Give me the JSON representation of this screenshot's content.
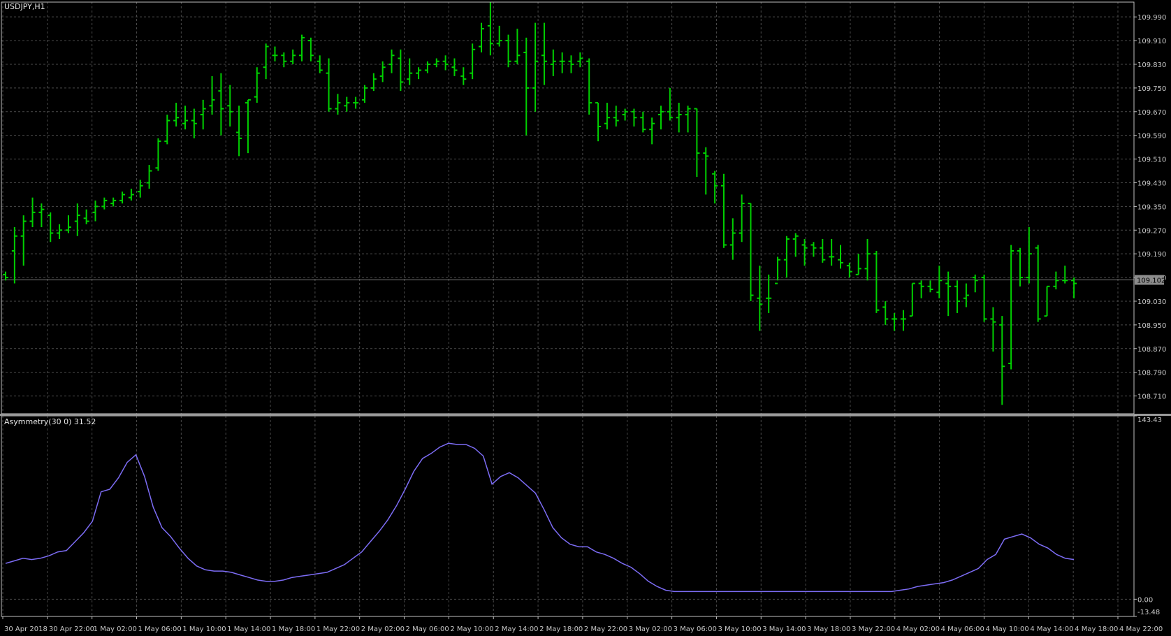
{
  "window": {
    "symbol_label": "USDJPY,H1",
    "indicator_label": "Asymmetry(30 0) 31.52"
  },
  "colors": {
    "background": "#000000",
    "grid": "#4a4a4a",
    "frame": "#c0c0c0",
    "bars": "#00d000",
    "indicator_line": "#7c6cf4",
    "bid_line": "#808080",
    "price_marker_bg": "#8c8c8c",
    "text": "#c8c8c8"
  },
  "chart_data": [
    {
      "type": "ohlc",
      "title": "USDJPY,H1",
      "bar_color": "#00d000",
      "y_ticks": [
        "109.990",
        "109.910",
        "109.830",
        "109.750",
        "109.670",
        "109.590",
        "109.510",
        "109.430",
        "109.350",
        "109.270",
        "109.190",
        "109.110",
        "109.030",
        "108.950",
        "108.870",
        "108.790",
        "108.710"
      ],
      "current_price": "109.102",
      "ylim": [
        108.65,
        110.04
      ],
      "x_ticks": [
        "30 Apr 2018",
        "30 Apr 22:00",
        "1 May 02:00",
        "1 May 06:00",
        "1 May 10:00",
        "1 May 14:00",
        "1 May 18:00",
        "1 May 22:00",
        "2 May 02:00",
        "2 May 06:00",
        "2 May 10:00",
        "2 May 14:00",
        "2 May 18:00",
        "2 May 22:00",
        "3 May 02:00",
        "3 May 06:00",
        "3 May 10:00",
        "3 May 14:00",
        "3 May 18:00",
        "3 May 22:00",
        "4 May 02:00",
        "4 May 06:00",
        "4 May 10:00",
        "4 May 14:00",
        "4 May 18:00",
        "4 May 22:00"
      ],
      "bars": [
        [
          109.12,
          109.13,
          109.1,
          109.11
        ],
        [
          109.2,
          109.28,
          109.09,
          109.25
        ],
        [
          109.25,
          109.32,
          109.15,
          109.3
        ],
        [
          109.3,
          109.38,
          109.28,
          109.33
        ],
        [
          109.33,
          109.36,
          109.28,
          109.34
        ],
        [
          109.32,
          109.33,
          109.23,
          109.26
        ],
        [
          109.26,
          109.29,
          109.24,
          109.27
        ],
        [
          109.27,
          109.32,
          109.26,
          109.28
        ],
        [
          109.3,
          109.36,
          109.25,
          109.32
        ],
        [
          109.31,
          109.34,
          109.29,
          109.3
        ],
        [
          109.33,
          109.37,
          109.3,
          109.35
        ],
        [
          109.35,
          109.38,
          109.34,
          109.37
        ],
        [
          109.36,
          109.38,
          109.35,
          109.37
        ],
        [
          109.37,
          109.4,
          109.36,
          109.39
        ],
        [
          109.38,
          109.41,
          109.37,
          109.39
        ],
        [
          109.4,
          109.44,
          109.38,
          109.42
        ],
        [
          109.43,
          109.49,
          109.41,
          109.47
        ],
        [
          109.48,
          109.58,
          109.47,
          109.57
        ],
        [
          109.57,
          109.66,
          109.56,
          109.64
        ],
        [
          109.64,
          109.7,
          109.62,
          109.65
        ],
        [
          109.63,
          109.69,
          109.61,
          109.64
        ],
        [
          109.64,
          109.68,
          109.58,
          109.63
        ],
        [
          109.66,
          109.71,
          109.61,
          109.68
        ],
        [
          109.69,
          109.79,
          109.66,
          109.71
        ],
        [
          109.74,
          109.8,
          109.59,
          109.68
        ],
        [
          109.69,
          109.76,
          109.62,
          109.67
        ],
        [
          109.6,
          109.69,
          109.52,
          109.58
        ],
        [
          109.7,
          109.71,
          109.53,
          109.71
        ],
        [
          109.72,
          109.82,
          109.7,
          109.8
        ],
        [
          109.82,
          109.9,
          109.78,
          109.89
        ],
        [
          109.86,
          109.89,
          109.84,
          109.86
        ],
        [
          109.86,
          109.87,
          109.82,
          109.84
        ],
        [
          109.84,
          109.88,
          109.83,
          109.86
        ],
        [
          109.86,
          109.93,
          109.84,
          109.92
        ],
        [
          109.91,
          109.92,
          109.84,
          109.86
        ],
        [
          109.84,
          109.86,
          109.8,
          109.81
        ],
        [
          109.8,
          109.85,
          109.67,
          109.68
        ],
        [
          109.68,
          109.73,
          109.66,
          109.7
        ],
        [
          109.69,
          109.72,
          109.67,
          109.7
        ],
        [
          109.7,
          109.72,
          109.68,
          109.7
        ],
        [
          109.71,
          109.76,
          109.7,
          109.75
        ],
        [
          109.75,
          109.8,
          109.74,
          109.78
        ],
        [
          109.79,
          109.84,
          109.77,
          109.82
        ],
        [
          109.83,
          109.88,
          109.8,
          109.86
        ],
        [
          109.85,
          109.88,
          109.74,
          109.77
        ],
        [
          109.78,
          109.85,
          109.76,
          109.8
        ],
        [
          109.8,
          109.82,
          109.78,
          109.81
        ],
        [
          109.81,
          109.84,
          109.8,
          109.83
        ],
        [
          109.83,
          109.85,
          109.82,
          109.84
        ],
        [
          109.84,
          109.86,
          109.81,
          109.83
        ],
        [
          109.82,
          109.85,
          109.79,
          109.81
        ],
        [
          109.79,
          109.82,
          109.76,
          109.78
        ],
        [
          109.8,
          109.9,
          109.78,
          109.88
        ],
        [
          109.89,
          109.97,
          109.87,
          109.95
        ],
        [
          109.96,
          110.04,
          109.86,
          109.9
        ],
        [
          109.9,
          109.96,
          109.89,
          109.91
        ],
        [
          109.91,
          109.93,
          109.82,
          109.84
        ],
        [
          109.84,
          109.95,
          109.83,
          109.86
        ],
        [
          109.87,
          109.92,
          109.59,
          109.75
        ],
        [
          109.75,
          109.97,
          109.67,
          109.84
        ],
        [
          109.86,
          109.97,
          109.76,
          109.84
        ],
        [
          109.83,
          109.88,
          109.79,
          109.84
        ],
        [
          109.84,
          109.87,
          109.8,
          109.84
        ],
        [
          109.84,
          109.86,
          109.8,
          109.83
        ],
        [
          109.84,
          109.87,
          109.82,
          109.85
        ],
        [
          109.84,
          109.85,
          109.66,
          109.7
        ],
        [
          109.7,
          109.7,
          109.57,
          109.62
        ],
        [
          109.63,
          109.7,
          109.61,
          109.65
        ],
        [
          109.65,
          109.69,
          109.62,
          109.64
        ],
        [
          109.66,
          109.68,
          109.64,
          109.67
        ],
        [
          109.67,
          109.68,
          109.62,
          109.65
        ],
        [
          109.65,
          109.67,
          109.6,
          109.61
        ],
        [
          109.61,
          109.65,
          109.56,
          109.63
        ],
        [
          109.66,
          109.69,
          109.61,
          109.67
        ],
        [
          109.67,
          109.75,
          109.64,
          109.65
        ],
        [
          109.65,
          109.7,
          109.6,
          109.66
        ],
        [
          109.66,
          109.69,
          109.6,
          109.68
        ],
        [
          109.68,
          109.68,
          109.45,
          109.53
        ],
        [
          109.53,
          109.55,
          109.39,
          109.52
        ],
        [
          109.46,
          109.47,
          109.36,
          109.42
        ],
        [
          109.42,
          109.46,
          109.21,
          109.22
        ],
        [
          109.22,
          109.31,
          109.17,
          109.26
        ],
        [
          109.26,
          109.39,
          109.23,
          109.36
        ],
        [
          109.36,
          109.36,
          109.03,
          109.05
        ],
        [
          109.04,
          109.15,
          108.93,
          109.02
        ],
        [
          109.04,
          109.12,
          108.99,
          109.04
        ],
        [
          109.09,
          109.18,
          109.1,
          109.17
        ],
        [
          109.17,
          109.25,
          109.11,
          109.24
        ],
        [
          109.24,
          109.26,
          109.18,
          109.25
        ],
        [
          109.22,
          109.24,
          109.15,
          109.21
        ],
        [
          109.22,
          109.23,
          109.18,
          109.21
        ],
        [
          109.21,
          109.24,
          109.16,
          109.17
        ],
        [
          109.18,
          109.24,
          109.15,
          109.18
        ],
        [
          109.17,
          109.22,
          109.14,
          109.16
        ],
        [
          109.15,
          109.16,
          109.11,
          109.13
        ],
        [
          109.12,
          109.19,
          109.12,
          109.14
        ],
        [
          109.14,
          109.24,
          109.1,
          109.19
        ],
        [
          109.19,
          109.2,
          108.99,
          109.0
        ],
        [
          109.01,
          109.03,
          108.95,
          108.97
        ],
        [
          108.97,
          108.99,
          108.93,
          108.97
        ],
        [
          108.97,
          109.0,
          108.93,
          108.97
        ],
        [
          108.98,
          109.09,
          108.98,
          109.09
        ],
        [
          109.09,
          109.1,
          109.04,
          109.08
        ],
        [
          109.08,
          109.1,
          109.06,
          109.07
        ],
        [
          109.06,
          109.15,
          109.04,
          109.1
        ],
        [
          109.09,
          109.13,
          108.98,
          109.08
        ],
        [
          109.08,
          109.1,
          108.99,
          109.03
        ],
        [
          109.04,
          109.09,
          109.01,
          109.05
        ],
        [
          109.11,
          109.12,
          109.06,
          109.1
        ],
        [
          109.11,
          109.12,
          108.96,
          108.97
        ],
        [
          108.97,
          109.01,
          108.86,
          108.96
        ],
        [
          108.95,
          108.98,
          108.68,
          108.81
        ],
        [
          108.82,
          109.22,
          108.8,
          109.2
        ],
        [
          109.2,
          109.21,
          109.08,
          109.11
        ],
        [
          109.11,
          109.28,
          109.09,
          109.19
        ],
        [
          109.21,
          109.22,
          108.96,
          108.97
        ],
        [
          108.98,
          109.08,
          108.98,
          109.08
        ],
        [
          109.08,
          109.13,
          109.07,
          109.1
        ],
        [
          109.1,
          109.15,
          109.09,
          109.1
        ],
        [
          109.1,
          109.11,
          109.04,
          109.09
        ]
      ]
    },
    {
      "type": "line",
      "title": "Asymmetry(30 0) 31.52",
      "y_ticks": [
        "143.43",
        "0.00",
        "-13.48"
      ],
      "ylim": [
        -13.48,
        143.43
      ],
      "values": [
        28,
        30,
        32,
        31,
        32,
        34,
        37,
        38,
        45,
        52,
        61,
        84,
        86,
        95,
        107,
        113,
        96,
        72,
        56,
        49,
        40,
        32,
        26,
        23,
        22,
        22,
        21,
        19,
        17,
        15,
        14,
        14,
        15,
        17,
        18,
        19,
        20,
        21,
        24,
        27,
        32,
        37,
        45,
        53,
        62,
        73,
        86,
        100,
        110,
        114,
        119,
        122,
        121,
        121,
        118,
        112,
        90,
        96,
        99,
        95,
        89,
        83,
        70,
        56,
        48,
        43,
        41,
        41,
        37,
        35,
        32,
        28,
        25,
        20,
        14,
        10,
        7,
        6,
        6,
        6,
        6,
        6,
        6,
        6,
        6,
        6,
        6,
        6,
        6,
        6,
        6,
        6,
        6,
        6,
        6,
        6,
        6,
        6,
        6,
        6,
        6,
        6,
        6,
        7,
        8,
        10,
        11,
        12,
        13,
        15,
        18,
        21,
        24,
        31,
        35,
        47,
        49,
        51,
        48,
        43,
        40,
        35,
        32,
        31
      ]
    }
  ]
}
